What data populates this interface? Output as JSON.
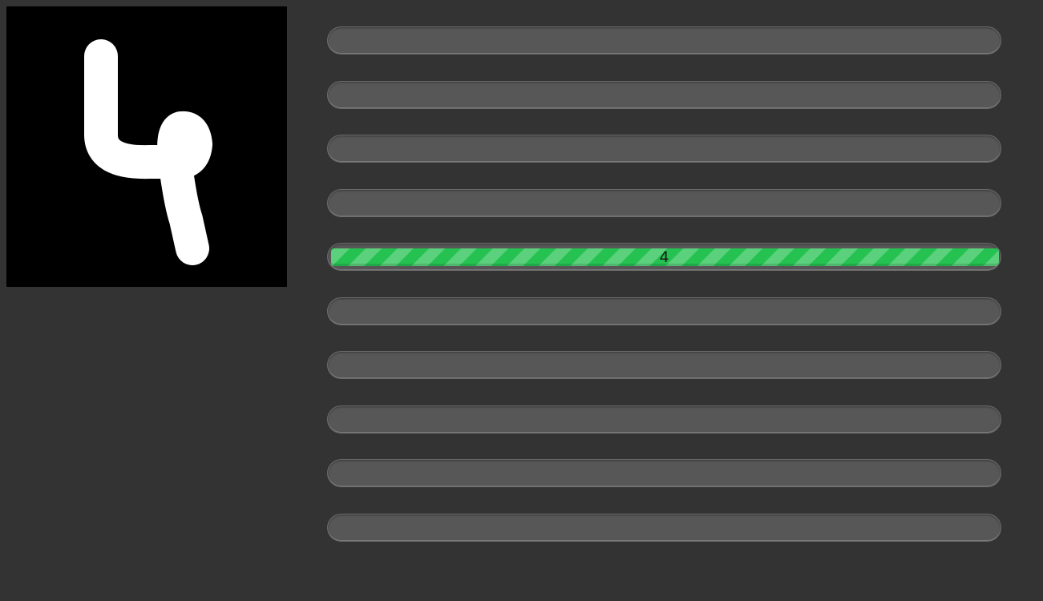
{
  "canvas": {
    "icon": "drawn-digit-4",
    "stroke_color": "#ffffff",
    "background_color": "#000000"
  },
  "predictions": [
    {
      "label": "",
      "value": 0
    },
    {
      "label": "",
      "value": 0
    },
    {
      "label": "",
      "value": 0
    },
    {
      "label": "",
      "value": 0
    },
    {
      "label": "4",
      "value": 1.0
    },
    {
      "label": "",
      "value": 0
    },
    {
      "label": "",
      "value": 0
    },
    {
      "label": "",
      "value": 0
    },
    {
      "label": "",
      "value": 0
    },
    {
      "label": "",
      "value": 0
    }
  ],
  "colors": {
    "background": "#333333",
    "bar_track": "#575757",
    "bar_fill": "#25c251"
  }
}
